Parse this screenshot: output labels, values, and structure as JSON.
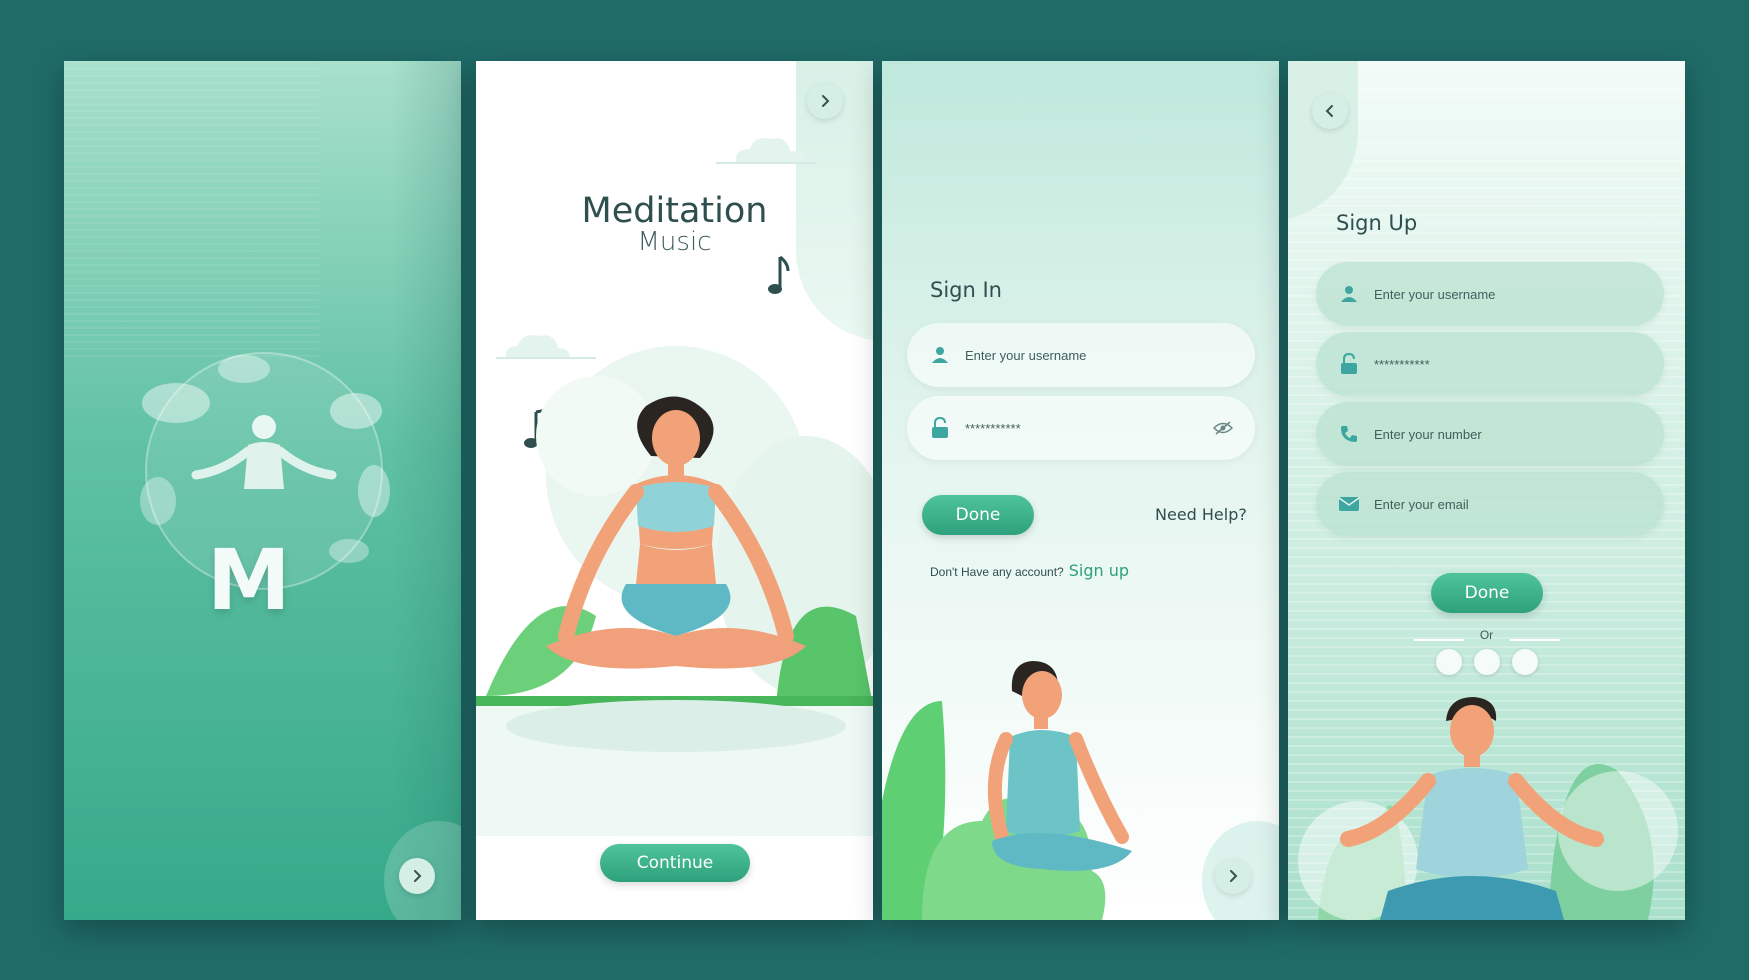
{
  "colors": {
    "background": "#1f6b68",
    "accent": "#2ea17c",
    "text": "#2f4f4f"
  },
  "splash": {
    "logo_letter": "M"
  },
  "intro": {
    "title": "Meditation",
    "subtitle": "Music",
    "continue_label": "Continue"
  },
  "signin": {
    "title": "Sign In",
    "username_placeholder": "Enter your username",
    "password_value": "***********",
    "done_label": "Done",
    "help_label": "Need Help?",
    "no_account_text": "Don't Have any account?",
    "signup_link": "Sign up"
  },
  "signup": {
    "title": "Sign Up",
    "username_placeholder": "Enter your username",
    "password_value": "***********",
    "number_placeholder": "Enter your number",
    "email_placeholder": "Enter your email",
    "done_label": "Done",
    "or_label": "Or"
  },
  "icons": [
    "chevron-right-icon",
    "chevron-left-icon",
    "user-icon",
    "lock-icon",
    "eye-off-icon",
    "phone-icon",
    "mail-icon",
    "music-note-icon",
    "cloud-icon"
  ]
}
